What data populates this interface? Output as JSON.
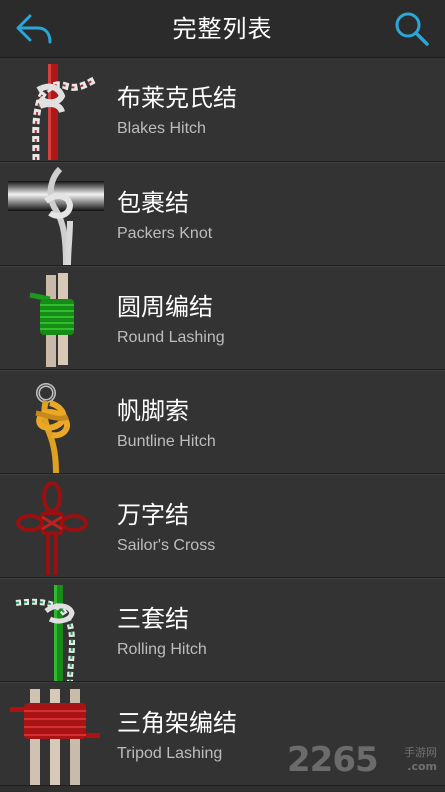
{
  "header": {
    "title": "完整列表",
    "back_icon": "back-arrow-icon",
    "search_icon": "search-icon",
    "accent_color": "#2aa7d8"
  },
  "knots": [
    {
      "name_cn": "布莱克氏结",
      "name_en": "Blakes Hitch",
      "thumbnail": "blakes-hitch-knot-icon"
    },
    {
      "name_cn": "包裹结",
      "name_en": "Packers Knot",
      "thumbnail": "packers-knot-icon"
    },
    {
      "name_cn": "圆周编结",
      "name_en": "Round Lashing",
      "thumbnail": "round-lashing-knot-icon"
    },
    {
      "name_cn": "帆脚索",
      "name_en": "Buntline Hitch",
      "thumbnail": "buntline-hitch-knot-icon"
    },
    {
      "name_cn": "万字结",
      "name_en": "Sailor's Cross",
      "thumbnail": "sailors-cross-knot-icon"
    },
    {
      "name_cn": "三套结",
      "name_en": "Rolling Hitch",
      "thumbnail": "rolling-hitch-knot-icon"
    },
    {
      "name_cn": "三角架编结",
      "name_en": "Tripod Lashing",
      "thumbnail": "tripod-lashing-knot-icon"
    }
  ],
  "watermark": {
    "number": "2265",
    "site_cn": "手游网",
    "site_domain": ".com"
  }
}
